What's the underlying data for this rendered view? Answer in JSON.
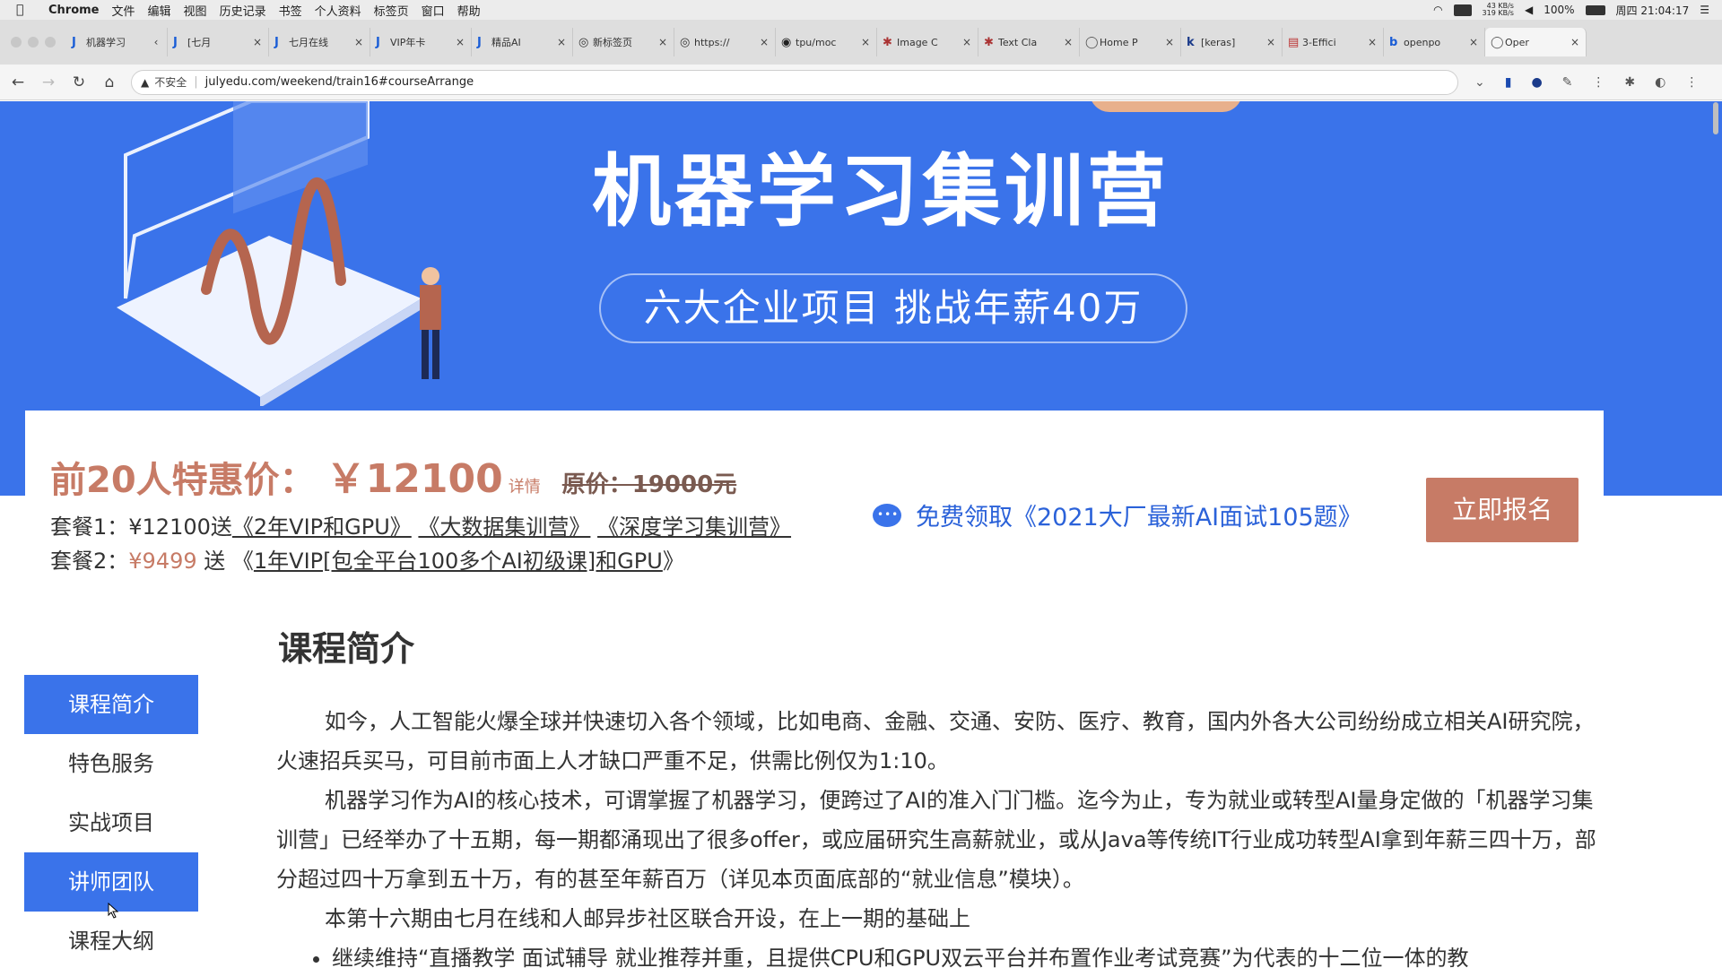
{
  "menubar": {
    "app": "Chrome",
    "items": [
      "文件",
      "编辑",
      "视图",
      "历史记录",
      "书签",
      "个人资料",
      "标签页",
      "窗口",
      "帮助"
    ],
    "net_up": "43 KB/s",
    "net_down": "319 KB/s",
    "battery": "100%",
    "clock": "周四 21:04:17"
  },
  "tabs": [
    {
      "icon": "J",
      "label": "机器学习"
    },
    {
      "icon": "J",
      "label": "[七月"
    },
    {
      "icon": "J",
      "label": "七月在线"
    },
    {
      "icon": "J",
      "label": "VIP年卡"
    },
    {
      "icon": "J",
      "label": "精品AI"
    },
    {
      "icon": "◎",
      "label": "新标签页"
    },
    {
      "icon": "◎",
      "label": "https://"
    },
    {
      "icon": "◉",
      "label": "tpu/moc"
    },
    {
      "icon": "✱",
      "label": "Image C"
    },
    {
      "icon": "✱",
      "label": "Text Cla"
    },
    {
      "icon": "◯",
      "label": "Home P"
    },
    {
      "icon": "k",
      "label": "[keras]"
    },
    {
      "icon": "▤",
      "label": "3-Effici"
    },
    {
      "icon": "b",
      "label": "openpo"
    },
    {
      "icon": "◯",
      "label": "Oper"
    }
  ],
  "address": {
    "insecure_label": "不安全",
    "url": "julyedu.com/weekend/train16#courseArrange"
  },
  "hero": {
    "title": "机器学习集训营",
    "subtitle": "六大企业项目  挑战年薪40万"
  },
  "pricing": {
    "label": "前20人特惠价：",
    "value": "￥12100",
    "detail": "详情",
    "original": "原价：19000元",
    "pkg1_prefix": "套餐1：¥12100送",
    "pkg1_links": [
      "《2年VIP和GPU》",
      "《大数据集训营》",
      "《深度学习集训营》"
    ],
    "pkg2_prefix": "套餐2：",
    "pkg2_price": "¥9499",
    "pkg2_mid": " 送 《",
    "pkg2_link": "1年VIP[包全平台100多个AI初级课]和GPU",
    "pkg2_suffix": "》",
    "free_offer": "免费领取《2021大厂最新AI面试105题》",
    "enroll": "立即报名"
  },
  "section_title": "课程简介",
  "sidenav": [
    "课程简介",
    "特色服务",
    "实战项目",
    "讲师团队",
    "课程大纲"
  ],
  "content": {
    "p1": "如今，人工智能火爆全球并快速切入各个领域，比如电商、金融、交通、安防、医疗、教育，国内外各大公司纷纷成立相关AI研究院，火速招兵买马，可目前市面上人才缺口严重不足，供需比例仅为1:10。",
    "p2": "机器学习作为AI的核心技术，可谓掌握了机器学习，便跨过了AI的准入门门槛。迄今为止，专为就业或转型AI量身定做的「机器学习集训营」已经举办了十五期，每一期都涌现出了很多offer，或应届研究生高薪就业，或从Java等传统IT行业成功转型AI拿到年薪三四十万，部分超过四十万拿到五十万，有的甚至年薪百万（详见本页面底部的“就业信息”模块）。",
    "p3": "本第十六期由七月在线和人邮异步社区联合开设，在上一期的基础上",
    "li1": "继续维持“直播教学 面试辅导 就业推荐并重，且提供CPU和GPU双云平台并布置作业考试竞赛”为代表的十二位一体的教"
  },
  "colors": {
    "brand_blue": "#3a73ea",
    "accent_salmon": "#c77b66"
  }
}
